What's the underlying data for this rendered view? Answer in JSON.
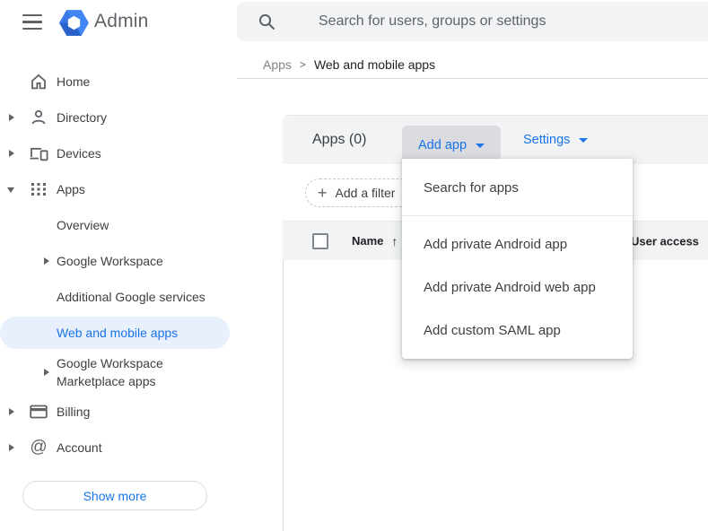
{
  "colors": {
    "accent_blue": "#1a73e8",
    "selected_item_bg": "#e8f0fe",
    "toolbar_bg": "#f1f3f4",
    "add_app_button_bg": "#dadce0",
    "text_primary": "#202124",
    "text_secondary": "#5f6368",
    "logo_blue": "#4285f4",
    "logo_blue_dark": "#2a62c9"
  },
  "header": {
    "product_name": "Admin",
    "search_placeholder": "Search for users, groups or settings"
  },
  "breadcrumb": {
    "parent": "Apps",
    "separator": ">",
    "current": "Web and mobile apps"
  },
  "sidebar": {
    "items": [
      {
        "label": "Home",
        "icon": "home-icon",
        "expandable": false
      },
      {
        "label": "Directory",
        "icon": "person-icon",
        "expandable": true
      },
      {
        "label": "Devices",
        "icon": "devices-icon",
        "expandable": true
      },
      {
        "label": "Apps",
        "icon": "apps-grid-icon",
        "expandable": true,
        "expanded": true
      },
      {
        "label": "Overview",
        "level": 2
      },
      {
        "label": "Google Workspace",
        "level": 2,
        "expandable": true
      },
      {
        "label": "Additional Google services",
        "level": 2
      },
      {
        "label": "Web and mobile apps",
        "level": 2,
        "selected": true
      },
      {
        "label": "Google Workspace Marketplace apps",
        "level": 2,
        "expandable": true
      },
      {
        "label": "Billing",
        "icon": "billing-icon",
        "expandable": true
      },
      {
        "label": "Account",
        "icon": "at-icon",
        "expandable": true
      }
    ],
    "show_more_label": "Show more"
  },
  "toolbar": {
    "title": "Apps (0)",
    "add_app_label": "Add app",
    "settings_label": "Settings"
  },
  "filter": {
    "add_filter_label": "Add a filter"
  },
  "table": {
    "columns": [
      {
        "label": "Name",
        "sort": "↑"
      },
      {
        "label": "User access"
      }
    ],
    "rows": [],
    "checkbox_checked": false
  },
  "add_app_menu": {
    "items": [
      {
        "label": "Search for apps"
      },
      {
        "label": "Add private Android app"
      },
      {
        "label": "Add private Android web app"
      },
      {
        "label": "Add custom SAML app"
      }
    ]
  },
  "icons": {
    "account_at": "@",
    "plus": "+"
  }
}
